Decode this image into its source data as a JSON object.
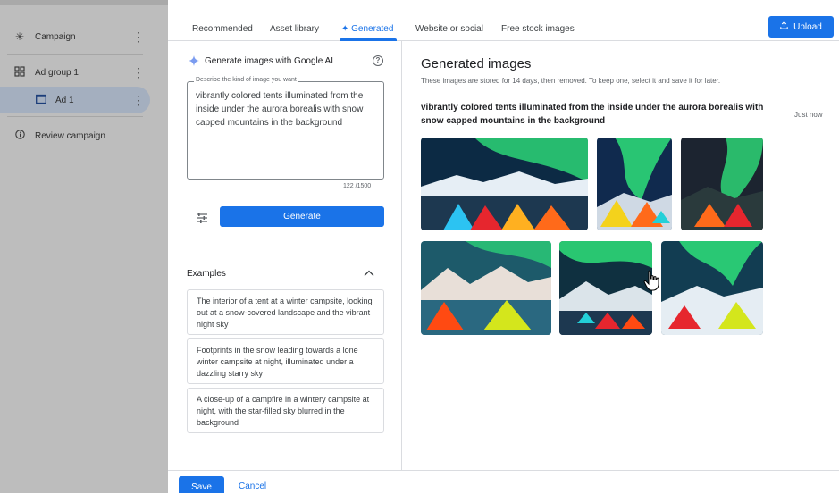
{
  "sidebar": {
    "items": [
      {
        "label": "Campaign",
        "icon": "asterisk-icon"
      },
      {
        "label": "Ad group 1",
        "icon": "grid-icon"
      },
      {
        "label": "Ad 1",
        "icon": "ad-icon"
      },
      {
        "label": "Review campaign",
        "icon": "info-icon"
      }
    ]
  },
  "tabs": [
    "Recommended",
    "Asset library",
    "✦ Generated",
    "Website or social",
    "Free stock images"
  ],
  "upload_label": "Upload",
  "form": {
    "title": "Generate images with Google AI",
    "prompt_label": "Describe the kind of image you want",
    "prompt_value": "vibrantly colored tents illuminated from the inside under the aurora borealis with snow capped mountains in the background",
    "char_count": "122 /1500",
    "generate_label": "Generate",
    "examples_title": "Examples",
    "examples": [
      "The interior of a tent at a winter campsite, looking out at a snow-covered landscape and the vibrant night sky",
      "Footprints in the snow leading towards a lone winter campsite at night, illuminated under a dazzling starry sky",
      "A close-up of a campfire in a wintery campsite at night, with the star-filled sky blurred in the background"
    ]
  },
  "results": {
    "title": "Generated images",
    "subtitle": "These images are stored for 14 days, then removed. To keep one, select it and save it for later.",
    "prompt": "vibrantly colored tents illuminated from the inside under the aurora borealis with snow capped mountains in the background",
    "timestamp": "Just now"
  },
  "footer": {
    "save_label": "Save",
    "cancel_label": "Cancel"
  },
  "colors": {
    "accent": "#1a73e8",
    "aurora": "#2ee07a",
    "tent_orange": "#ff6a1a",
    "tent_yellow": "#f4d21c"
  }
}
